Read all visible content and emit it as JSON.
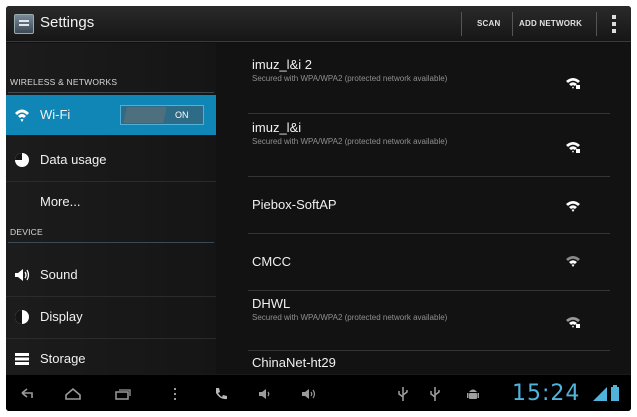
{
  "app": {
    "title": "Settings",
    "icon": "settings-app-icon"
  },
  "actionbar": {
    "scan_label": "SCAN",
    "add_network_label": "ADD NETWORK",
    "overflow_icon": "overflow-menu-icon"
  },
  "sidebar": {
    "sections": [
      {
        "header": "WIRELESS & NETWORKS"
      },
      {
        "header": "DEVICE"
      }
    ],
    "items": [
      {
        "label": "Wi-Fi",
        "icon": "wifi-icon",
        "selected": true,
        "toggle": "ON"
      },
      {
        "label": "Data usage",
        "icon": "data-usage-icon"
      },
      {
        "label": "More..."
      },
      {
        "label": "Sound",
        "icon": "speaker-icon"
      },
      {
        "label": "Display",
        "icon": "display-icon"
      },
      {
        "label": "Storage",
        "icon": "storage-icon"
      }
    ]
  },
  "networks": [
    {
      "name": "imuz_l&i 2",
      "status": "Secured with WPA/WPA2 (protected network available)",
      "icon": "wifi-secured-icon"
    },
    {
      "name": "imuz_l&i",
      "status": "Secured with WPA/WPA2 (protected network available)",
      "icon": "wifi-secured-icon"
    },
    {
      "name": "Piebox-SoftAP",
      "status": "",
      "icon": "wifi-signal-icon"
    },
    {
      "name": "CMCC",
      "status": "",
      "icon": "wifi-signal-icon"
    },
    {
      "name": "DHWL",
      "status": "Secured with WPA/WPA2 (protected network available)",
      "icon": "wifi-secured-icon"
    },
    {
      "name": "ChinaNet-ht29",
      "status": "",
      "icon": "wifi-signal-icon"
    }
  ],
  "systembar": {
    "clock": "15:24",
    "icons": [
      "back-icon",
      "home-icon",
      "recent-apps-icon",
      "menu-icon",
      "phone-icon",
      "volume-down-icon",
      "volume-up-icon",
      "usb-icon",
      "usb-debug-icon",
      "android-icon",
      "wifi-status-icon",
      "battery-icon"
    ]
  },
  "colors": {
    "accent": "#0f86b5",
    "clock": "#4fb3dc",
    "background": "#101010"
  }
}
